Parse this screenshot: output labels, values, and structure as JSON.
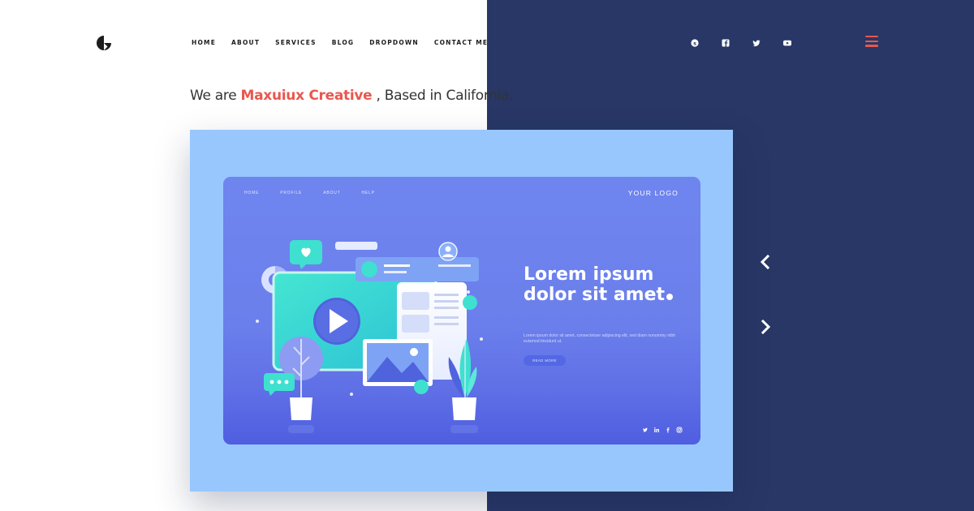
{
  "nav": {
    "items": [
      "HOME",
      "ABOUT",
      "SERVICES",
      "BLOG",
      "DROPDOWN",
      "CONTACT ME"
    ]
  },
  "social_top": [
    "skype-icon",
    "facebook-icon",
    "twitter-icon",
    "youtube-icon"
  ],
  "tagline": {
    "prefix": "We are",
    "brand": "Maxuiux Creative",
    "suffix": ", Based in California."
  },
  "mockup": {
    "nav": [
      "HOME",
      "PROFILE",
      "ABOUT",
      "HELP"
    ],
    "logo": "YOUR LOGO",
    "title": "Lorem ipsum dolor sit amet",
    "body": "Lorem ipsum dolor sit amet, consectetuer adipiscing elit, sed diam nonummy nibh euismod tincidunt ut.",
    "button": "READ MORE",
    "social": [
      "twitter-icon",
      "linkedin-icon",
      "facebook-icon",
      "instagram-icon"
    ]
  },
  "colors": {
    "accent": "#e9574f",
    "dark_panel": "#283766",
    "card_bg": "#98c7fd",
    "inner_bg": "#6b7fec",
    "teal": "#3fe0cf"
  }
}
